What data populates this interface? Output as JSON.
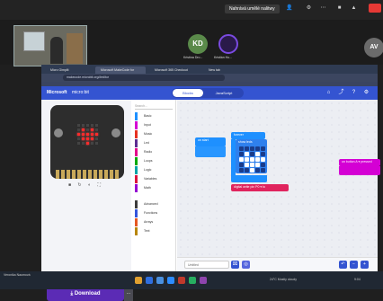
{
  "meeting": {
    "title": "Nahrává umělé nalitwy",
    "participants": [
      {
        "initials": "KD",
        "name": "Kristína Dro..."
      },
      {
        "initials": "",
        "name": "Kristián Ho..."
      },
      {
        "initials": "AV",
        "name": ""
      }
    ]
  },
  "browser": {
    "tabs": [
      "Micro Gimplit",
      "Microsoft MakeCode for micro:bit",
      "Microsoft 365 Checkout",
      "New tab"
    ],
    "url": "makecode.microbit.org/#editor"
  },
  "makecode": {
    "logo": "Microsoft",
    "brand": "micro:bit",
    "mode_blocks": "Blocks",
    "mode_js": "JavaScript",
    "sim_controls": "■ ↻ ◐ ⛶",
    "download_label": "Download",
    "download_more": "···",
    "search_placeholder": "Search...",
    "categories": [
      {
        "label": "Basic",
        "color": "#1e90ff"
      },
      {
        "label": "Input",
        "color": "#d400d4"
      },
      {
        "label": "Music",
        "color": "#e63022"
      },
      {
        "label": "Led",
        "color": "#5c2d91"
      },
      {
        "label": "Radio",
        "color": "#e3008c"
      },
      {
        "label": "Loops",
        "color": "#00aa00"
      },
      {
        "label": "Logic",
        "color": "#00a4a6"
      },
      {
        "label": "Variables",
        "color": "#dc143c"
      },
      {
        "label": "Math",
        "color": "#9400d3"
      },
      {
        "label": "Advanced",
        "color": "#3c3c3c"
      },
      {
        "label": "Functions",
        "color": "#3455db"
      },
      {
        "label": "Arrays",
        "color": "#e65722"
      },
      {
        "label": "Text",
        "color": "#b8860b"
      }
    ],
    "blocks": {
      "on_start": "on start",
      "forever": "forever",
      "show_leds": "show leds",
      "digital_write": "digital write pin  P0 ▾  to",
      "on_button": "on button  A ▾  pressed"
    },
    "project_name": "Untitled",
    "led_pattern_sim": [
      0,
      0,
      0,
      0,
      0,
      0,
      1,
      0,
      1,
      0,
      1,
      1,
      1,
      1,
      1,
      0,
      1,
      1,
      1,
      0,
      0,
      0,
      1,
      0,
      0
    ],
    "led_pattern_block": [
      0,
      0,
      0,
      0,
      0,
      0,
      1,
      0,
      1,
      0,
      1,
      1,
      1,
      1,
      1,
      0,
      1,
      1,
      1,
      0,
      0,
      0,
      1,
      0,
      0
    ]
  },
  "taskbar": {
    "left_text": "Veronika Naumová",
    "weather": "24°C Mostly cloudy",
    "time": "9:04"
  }
}
